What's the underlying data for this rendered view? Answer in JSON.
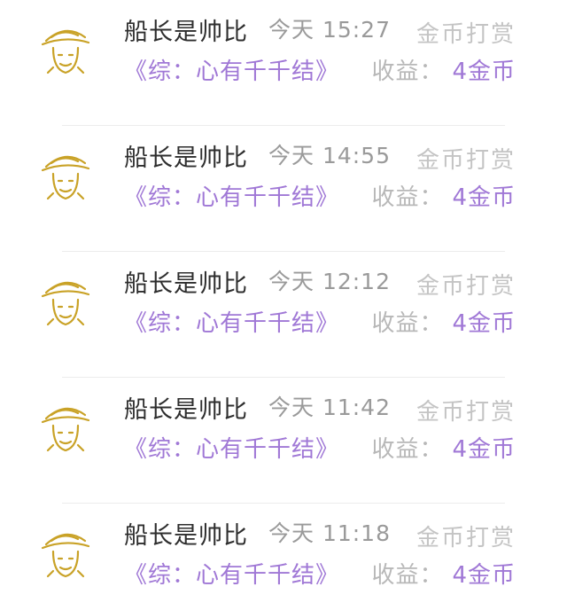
{
  "rows": [
    {
      "user": "船长是帅比",
      "time": "今天 15:27",
      "action": "金币打赏",
      "book": "《综：心有千千结》",
      "earning_label": "收益：",
      "earning_value": "4金币"
    },
    {
      "user": "船长是帅比",
      "time": "今天 14:55",
      "action": "金币打赏",
      "book": "《综：心有千千结》",
      "earning_label": "收益：",
      "earning_value": "4金币"
    },
    {
      "user": "船长是帅比",
      "time": "今天 12:12",
      "action": "金币打赏",
      "book": "《综：心有千千结》",
      "earning_label": "收益：",
      "earning_value": "4金币"
    },
    {
      "user": "船长是帅比",
      "time": "今天 11:42",
      "action": "金币打赏",
      "book": "《综：心有千千结》",
      "earning_label": "收益：",
      "earning_value": "4金币"
    },
    {
      "user": "船长是帅比",
      "time": "今天 11:18",
      "action": "金币打赏",
      "book": "《综：心有千千结》",
      "earning_label": "收益：",
      "earning_value": "4金币"
    }
  ],
  "colors": {
    "accent": "#a078d6",
    "name": "#2e2e2e",
    "muted": "#c4c4c4",
    "avatar_gold": "#c9a227"
  },
  "icons": {
    "avatar": "straw-hat-avatar-icon"
  }
}
